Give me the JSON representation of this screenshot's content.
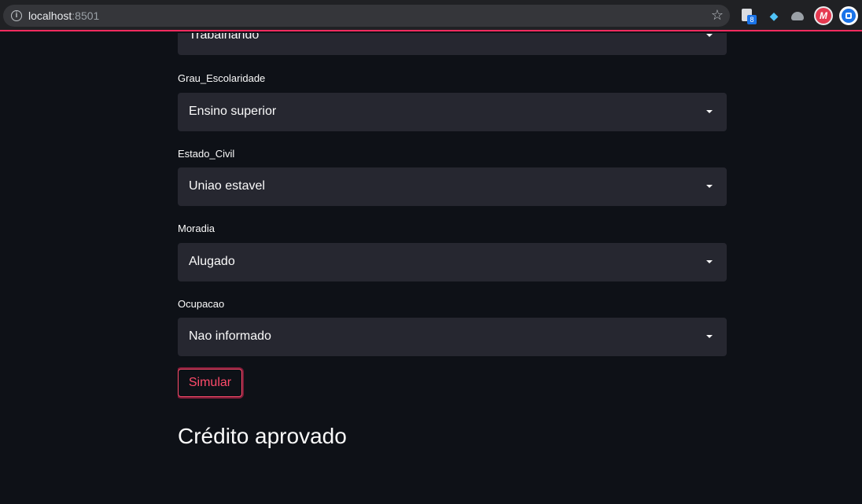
{
  "browser": {
    "host": "localhost",
    "port": ":8501",
    "extension_badge": "8",
    "icons": [
      "info-icon",
      "star-icon",
      "document-extension-icon",
      "gem-extension-icon",
      "cloud-extension-icon",
      "m-extension-icon",
      "camera-extension-icon"
    ]
  },
  "form": {
    "fields": [
      {
        "label": "",
        "value": "Trabalhando"
      },
      {
        "label": "Grau_Escolaridade",
        "value": "Ensino superior"
      },
      {
        "label": "Estado_Civil",
        "value": "Uniao estavel"
      },
      {
        "label": "Moradia",
        "value": "Alugado"
      },
      {
        "label": "Ocupacao",
        "value": "Nao informado"
      }
    ],
    "submit_label": "Simular"
  },
  "result": {
    "text": "Crédito aprovado"
  },
  "colors": {
    "background": "#0e1117",
    "select_background": "#262730",
    "accent": "#ff4b6b",
    "text": "#fafafa"
  }
}
